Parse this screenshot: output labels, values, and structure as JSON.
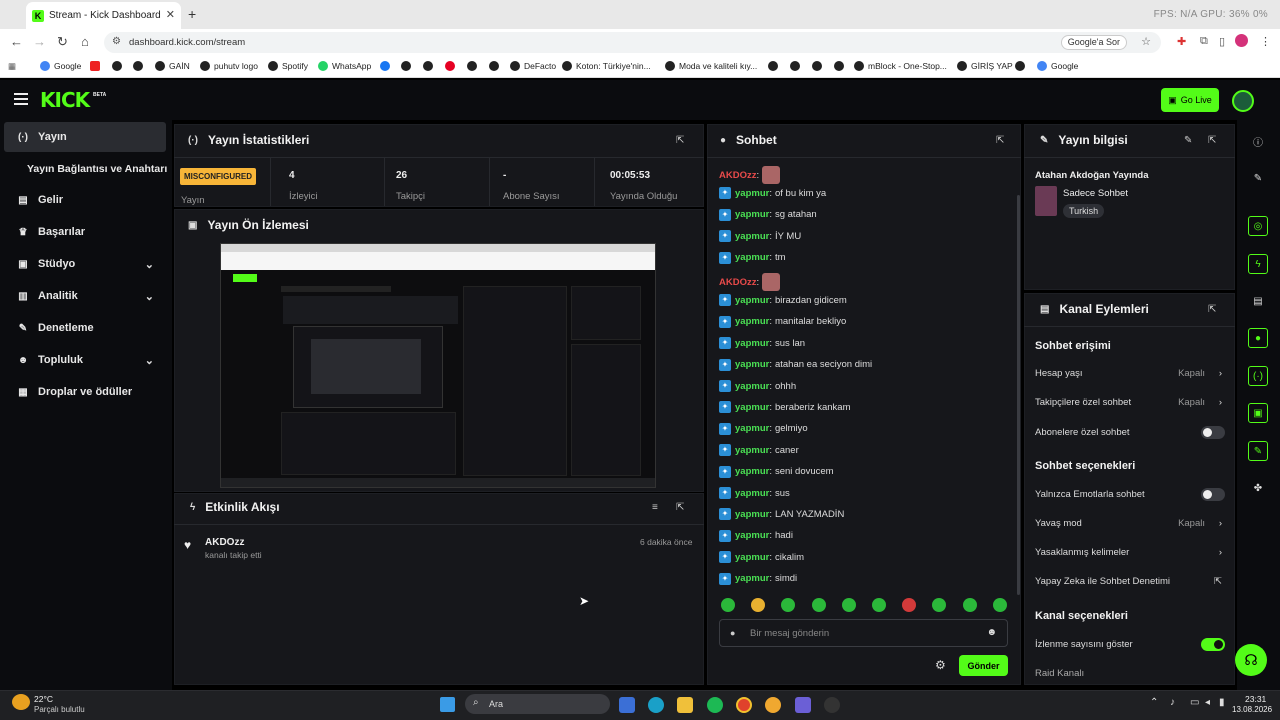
{
  "browser": {
    "tab_title": "Stream - Kick Dashboard",
    "url": "dashboard.kick.com/stream",
    "google_sor": "Google'a Sor",
    "perf": "FPS: N/A   GPU: 36%   0%",
    "bookmarks": [
      "Google",
      "GAİN",
      "puhutv logo",
      "Spotify",
      "WhatsApp",
      "DeFacto",
      "Koton: Türkiye'nin...",
      "Moda ve kaliteli kıy...",
      "mBlock - One-Stop...",
      "GİRİŞ YAP",
      "Google"
    ]
  },
  "kick": {
    "logo": "KICK",
    "beta": "BETA",
    "go_live": "Go Live"
  },
  "sidebar": {
    "items": [
      {
        "label": "Yayın",
        "icon": "(·)"
      },
      {
        "label": "Yayın Bağlantısı ve Anahtarı",
        "icon": ""
      },
      {
        "label": "Gelir",
        "icon": "▤"
      },
      {
        "label": "Başarılar",
        "icon": "🏆"
      },
      {
        "label": "Stüdyo",
        "icon": "▣"
      },
      {
        "label": "Analitik",
        "icon": "▥"
      },
      {
        "label": "Denetleme",
        "icon": "🔧"
      },
      {
        "label": "Topluluk",
        "icon": "☻"
      },
      {
        "label": "Droplar ve ödüller",
        "icon": "▦"
      }
    ]
  },
  "stats": {
    "title": "Yayın İstatistikleri",
    "badge": "MISCONFIGURED",
    "status_label": "Yayın",
    "items": [
      {
        "value": "4",
        "label": "İzleyici"
      },
      {
        "value": "26",
        "label": "Takipçi"
      },
      {
        "value": "-",
        "label": "Abone Sayısı"
      },
      {
        "value": "00:05:53",
        "label": "Yayında Olduğu"
      }
    ]
  },
  "preview": {
    "title": "Yayın Ön İzlemesi"
  },
  "activity": {
    "title": "Etkinlik Akışı",
    "user": "AKDOzz",
    "action": "kanalı takip etti",
    "time": "6 dakika önce"
  },
  "chat": {
    "title": "Sohbet",
    "placeholder": "Bir mesaj gönderin",
    "send": "Gönder",
    "messages": [
      {
        "user": "AKDOzz",
        "text": "",
        "type": "owner"
      },
      {
        "user": "yapmur",
        "text": "of bu kim ya"
      },
      {
        "user": "yapmur",
        "text": "sg atahan"
      },
      {
        "user": "yapmur",
        "text": "İY MU"
      },
      {
        "user": "yapmur",
        "text": "tm"
      },
      {
        "user": "AKDOzz",
        "text": "",
        "type": "owner"
      },
      {
        "user": "yapmur",
        "text": "birazdan gidicem"
      },
      {
        "user": "yapmur",
        "text": "manitalar bekliyo"
      },
      {
        "user": "yapmur",
        "text": "sus lan"
      },
      {
        "user": "yapmur",
        "text": "atahan ea seciyon dimi"
      },
      {
        "user": "yapmur",
        "text": "ohhh"
      },
      {
        "user": "yapmur",
        "text": "beraberiz kankam"
      },
      {
        "user": "yapmur",
        "text": "gelmiyo"
      },
      {
        "user": "yapmur",
        "text": "caner"
      },
      {
        "user": "yapmur",
        "text": "seni dovucem"
      },
      {
        "user": "yapmur",
        "text": "sus"
      },
      {
        "user": "yapmur",
        "text": "LAN YAZMADİN"
      },
      {
        "user": "yapmur",
        "text": "hadi"
      },
      {
        "user": "yapmur",
        "text": "cikalim"
      },
      {
        "user": "yapmur",
        "text": "simdi"
      }
    ]
  },
  "info": {
    "title": "Yayın bilgisi",
    "stream_title": "Atahan Akdoğan Yayında",
    "category": "Sadece Sohbet",
    "tag": "Turkish"
  },
  "actions": {
    "title": "Kanal Eylemleri",
    "access_title": "Sohbet erişimi",
    "options_title": "Sohbet seçenekleri",
    "channel_title": "Kanal seçenekleri",
    "rows": [
      {
        "label": "Hesap yaşı",
        "value": "Kapalı"
      },
      {
        "label": "Takipçilere özel sohbet",
        "value": "Kapalı"
      },
      {
        "label": "Abonelere özel sohbet"
      },
      {
        "label": "Yalnızca Emotlarla sohbet"
      },
      {
        "label": "Yavaş mod",
        "value": "Kapalı"
      },
      {
        "label": "Yasaklanmış kelimeler"
      },
      {
        "label": "Yapay Zeka ile Sohbet Denetimi"
      },
      {
        "label": "İzlenme sayısını göster"
      },
      {
        "label": "Raid Kanalı"
      }
    ],
    "toggles": {
      "subs_only": false,
      "emotes_only": false,
      "show_viewers": true
    }
  },
  "taskbar": {
    "temp": "22°C",
    "weather": "Parçalı bulutlu",
    "search": "Ara",
    "time": "23:31",
    "date": "13.08.2026"
  }
}
